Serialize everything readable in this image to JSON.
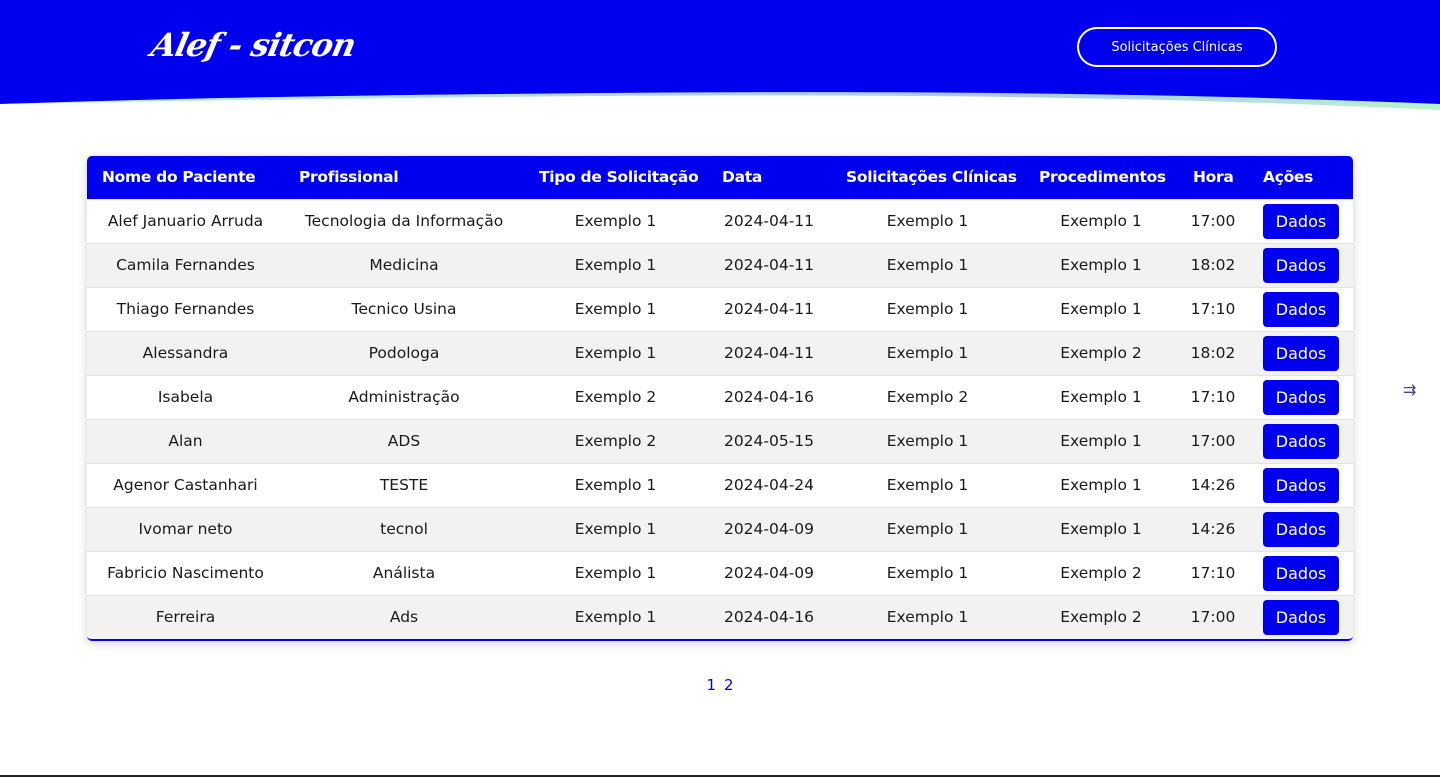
{
  "header": {
    "logo_text": "Alef - sitcon",
    "nav_button": "Solicitações Clínicas"
  },
  "colors": {
    "primary": "#0000ee",
    "wave_accent_start": "#b7f5c8",
    "wave_accent_end": "#a9c8ef"
  },
  "table": {
    "columns": [
      "Nome do Paciente",
      "Profissional",
      "Tipo de Solicitação",
      "Data",
      "Solicitações Clínicas",
      "Procedimentos",
      "Hora",
      "Ações"
    ],
    "action_label": "Dados",
    "rows": [
      [
        "Alef Januario Arruda",
        "Tecnologia da Informação",
        "Exemplo 1",
        "2024-04-11",
        "Exemplo 1",
        "Exemplo 1",
        "17:00"
      ],
      [
        "Camila Fernandes",
        "Medicina",
        "Exemplo 1",
        "2024-04-11",
        "Exemplo 1",
        "Exemplo 1",
        "18:02"
      ],
      [
        "Thiago Fernandes",
        "Tecnico Usina",
        "Exemplo 1",
        "2024-04-11",
        "Exemplo 1",
        "Exemplo 1",
        "17:10"
      ],
      [
        "Alessandra",
        "Podologa",
        "Exemplo 1",
        "2024-04-11",
        "Exemplo 1",
        "Exemplo 2",
        "18:02"
      ],
      [
        "Isabela",
        "Administração",
        "Exemplo 2",
        "2024-04-16",
        "Exemplo 2",
        "Exemplo 1",
        "17:10"
      ],
      [
        "Alan",
        "ADS",
        "Exemplo 2",
        "2024-05-15",
        "Exemplo 1",
        "Exemplo 1",
        "17:00"
      ],
      [
        "Agenor Castanhari",
        "TESTE",
        "Exemplo 1",
        "2024-04-24",
        "Exemplo 1",
        "Exemplo 1",
        "14:26"
      ],
      [
        "Ivomar neto",
        "tecnol",
        "Exemplo 1",
        "2024-04-09",
        "Exemplo 1",
        "Exemplo 1",
        "14:26"
      ],
      [
        "Fabricio Nascimento",
        "Análista",
        "Exemplo 1",
        "2024-04-09",
        "Exemplo 1",
        "Exemplo 2",
        "17:10"
      ],
      [
        "Ferreira",
        "Ads",
        "Exemplo 1",
        "2024-04-16",
        "Exemplo 1",
        "Exemplo 2",
        "17:00"
      ]
    ]
  },
  "pagination": {
    "pages": [
      "1",
      "2"
    ]
  },
  "side_arrow": {
    "icon": "arrow-right-icon",
    "glyph": "⇉"
  }
}
